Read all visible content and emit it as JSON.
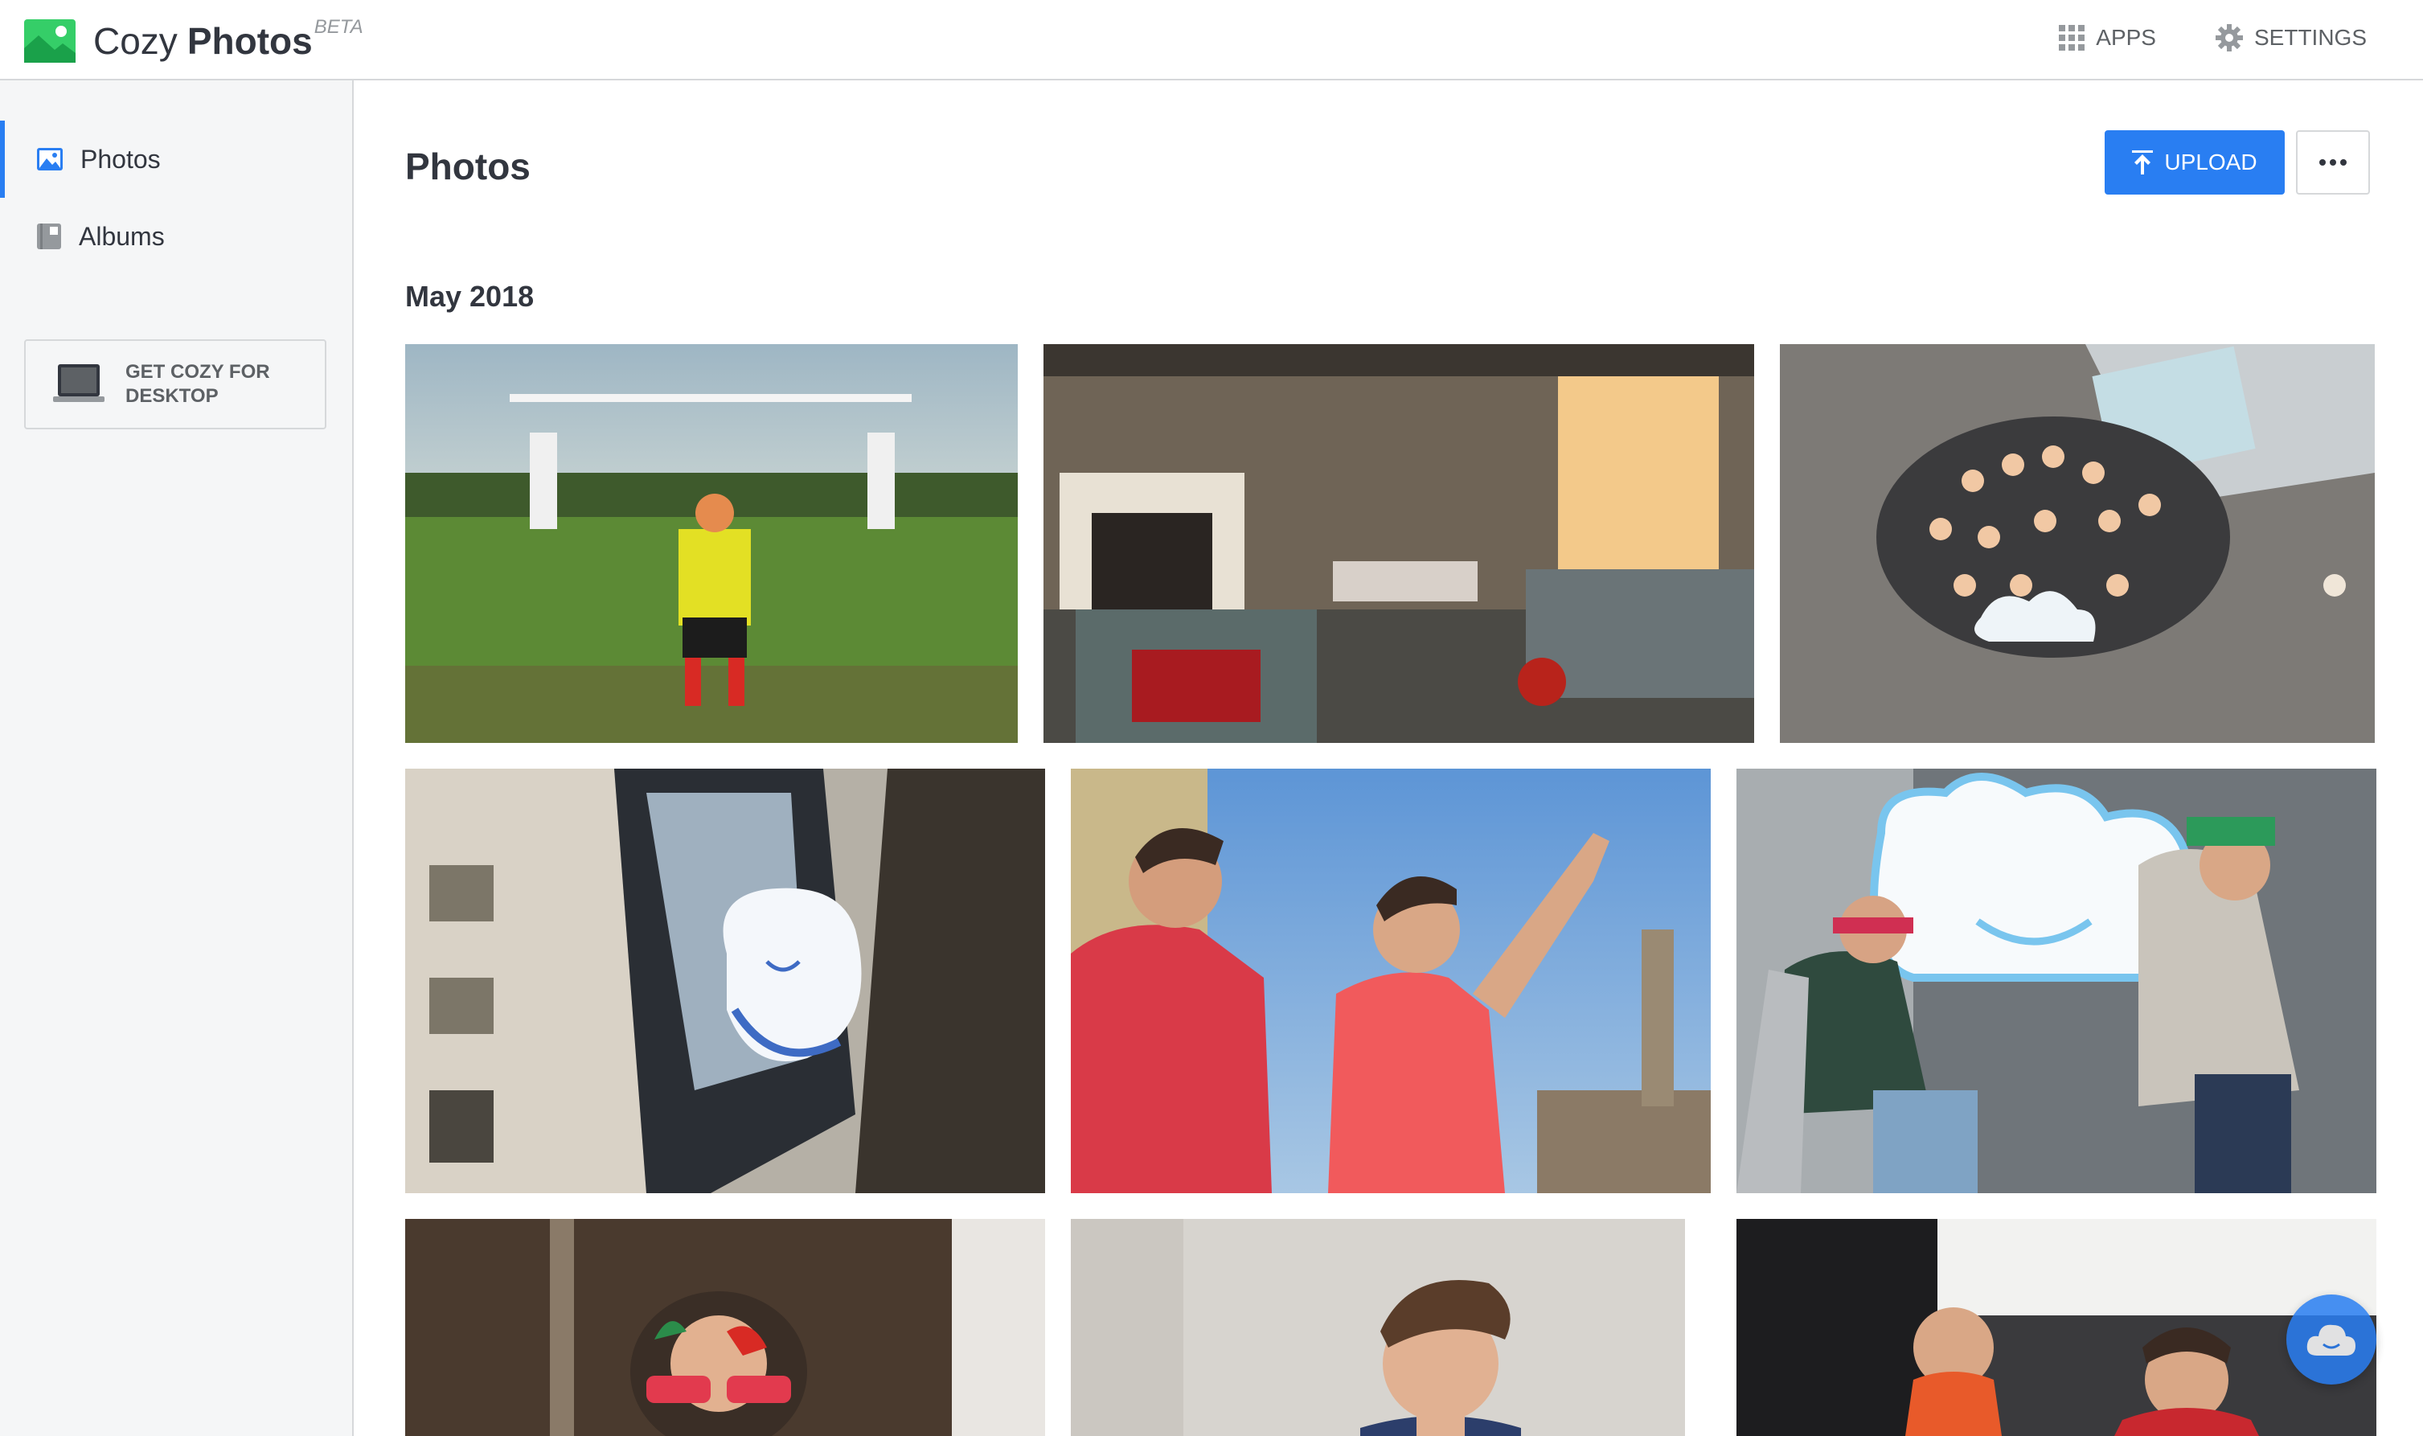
{
  "app": {
    "name_part1": "Cozy",
    "name_part2": "Photos",
    "beta": "BETA",
    "logo_icon": "image-icon"
  },
  "topnav": {
    "apps_label": "APPS",
    "apps_icon": "grid-icon",
    "settings_label": "SETTINGS",
    "settings_icon": "gear-icon"
  },
  "sidebar": {
    "items": [
      {
        "label": "Photos",
        "icon": "photo-icon",
        "active": true
      },
      {
        "label": "Albums",
        "icon": "album-icon",
        "active": false
      }
    ],
    "desktop_cta": "GET COZY FOR DESKTOP"
  },
  "main": {
    "title": "Photos",
    "upload_label": "UPLOAD",
    "more_icon": "more-dots-icon",
    "section_title": "May 2018"
  },
  "colors": {
    "accent": "#297ef2",
    "sidebar_bg": "#f5f6f7",
    "border": "#d6d8da",
    "text": "#32363f"
  }
}
